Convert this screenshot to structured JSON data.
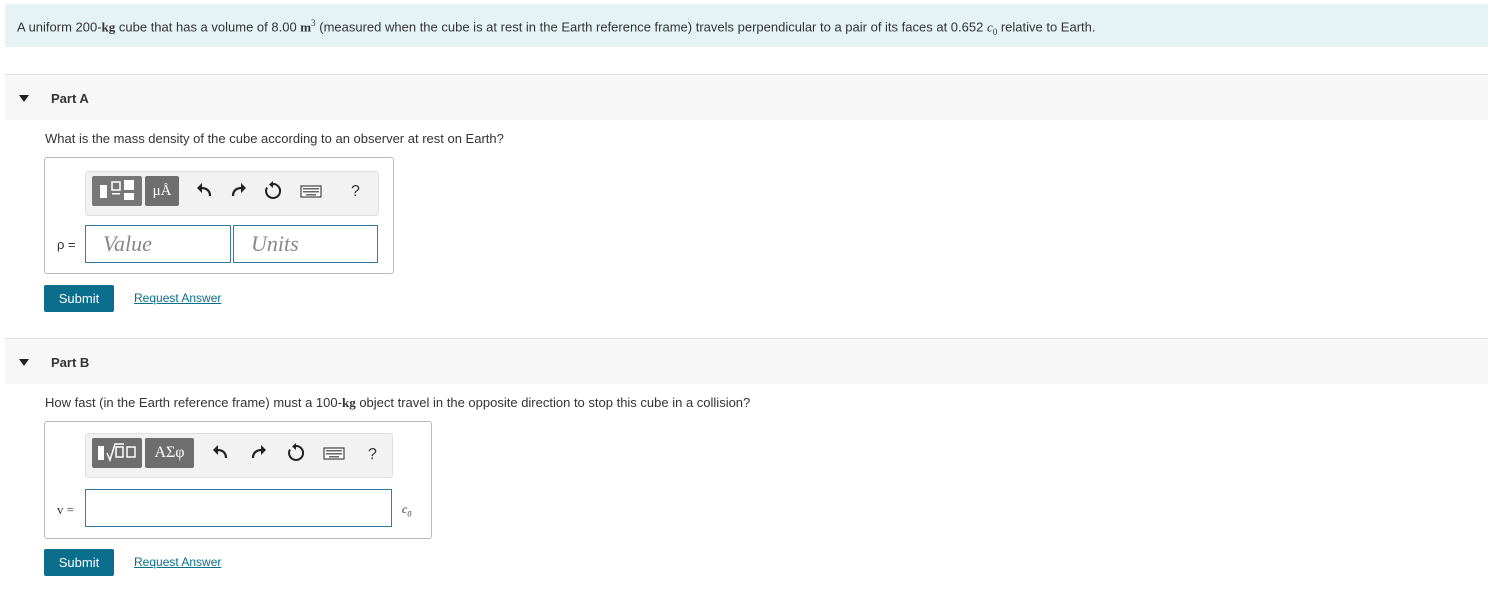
{
  "problem": {
    "t1": "A uniform 200-",
    "kg": "kg",
    "t2": " cube that has a volume of 8.00 ",
    "m": "m",
    "exp": "3",
    "t3": " (measured when the cube is at rest in the Earth reference frame) travels perpendicular to a pair of its faces at 0.652 ",
    "c": "c",
    "sub0": "0",
    "t4": " relative to Earth."
  },
  "partA": {
    "title": "Part A",
    "question": "What is the mass density of the cube according to an observer at rest on Earth?",
    "symbol": "ρ =",
    "value_placeholder": "Value",
    "units_placeholder": "Units",
    "unit_button": "μÅ",
    "help": "?",
    "submit": "Submit",
    "request": "Request Answer"
  },
  "partB": {
    "title": "Part B",
    "q1": "How fast (in the Earth reference frame) must a 100-",
    "kg": "kg",
    "q2": " object travel in the opposite direction to stop this cube in a collision?",
    "symbol": "v =",
    "greek_button": "ΑΣφ",
    "help": "?",
    "unit": "c",
    "unit_sub": "0",
    "input_value": "",
    "submit": "Submit",
    "request": "Request Answer"
  }
}
